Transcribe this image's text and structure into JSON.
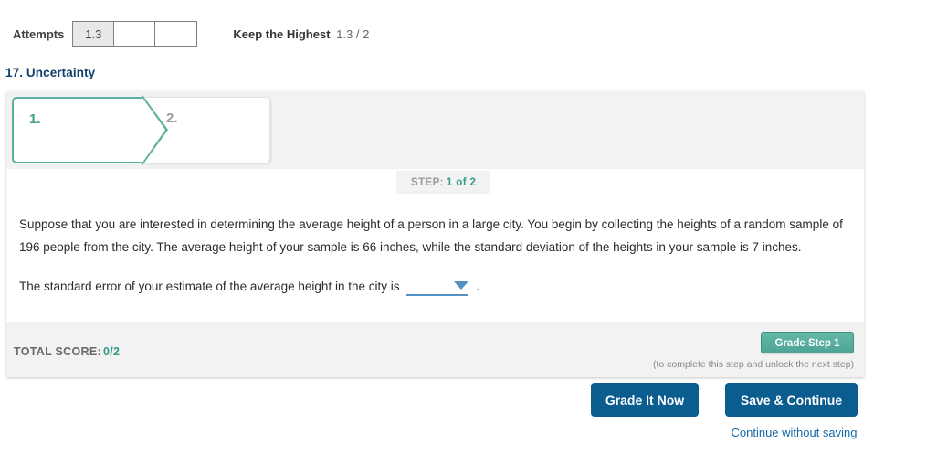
{
  "attempts": {
    "label": "Attempts",
    "boxes": [
      "1.3",
      "",
      ""
    ],
    "keep_highest_label": "Keep the Highest",
    "keep_highest_value": "1.3 / 2"
  },
  "question": {
    "title": "17. Uncertainty"
  },
  "tabs": [
    {
      "label": "1.",
      "state": "active"
    },
    {
      "label": "2.",
      "state": "inactive"
    }
  ],
  "step": {
    "label": "STEP:",
    "value": "1 of 2"
  },
  "body": {
    "paragraph": "Suppose that you are interested in determining the average height of a person in a large city. You begin by collecting the heights of a random sample of 196 people from the city. The average height of your sample is 66 inches, while the standard deviation of the heights in your sample is 7 inches.",
    "prompt_prefix": "The standard error of your estimate of the average height in the city is",
    "dropdown_value": "",
    "dropdown_placeholder": "",
    "prompt_suffix": "."
  },
  "footer": {
    "total_score_label": "TOTAL SCORE:",
    "total_score_value": "0/2",
    "grade_step_label": "Grade Step 1",
    "grade_hint": "(to complete this step and unlock the next step)"
  },
  "actions": {
    "grade_it_now": "Grade It Now",
    "save_continue": "Save & Continue",
    "continue_without_saving": "Continue without saving"
  },
  "colors": {
    "accent_blue": "#0b5c8f",
    "accent_teal": "#2f9c8b",
    "title_navy": "#12406e",
    "link_blue": "#1769a8",
    "dropdown_blue": "#5590c4"
  }
}
